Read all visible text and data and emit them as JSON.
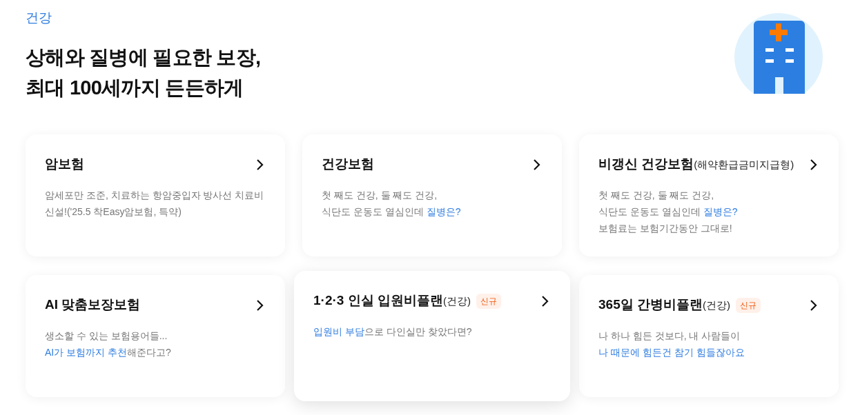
{
  "category": "건강",
  "headline": [
    "상해와 질병에 필요한 보장,",
    "최대 100세까지 든든하게"
  ],
  "cards": [
    {
      "title": "암보험",
      "raised": false,
      "lines": [
        [
          {
            "text": "암세포만 조준, 치료하는 항암중입자 방사선 치료비",
            "highlight": false
          }
        ],
        [
          {
            "text": "신설!('25.5 착Easy암보험, 특약)",
            "highlight": false
          }
        ]
      ]
    },
    {
      "title": "건강보험",
      "raised": false,
      "lines": [
        [
          {
            "text": "첫 째도 건강, 둘 째도 건강,",
            "highlight": false
          }
        ],
        [
          {
            "text": "식단도 운동도 열심인데 ",
            "highlight": false
          },
          {
            "text": "질병은?",
            "highlight": true
          }
        ]
      ]
    },
    {
      "title": "비갱신 건강보험",
      "title_suffix": "(해약환급금미지급형)",
      "raised": false,
      "lines": [
        [
          {
            "text": "첫 째도 건강, 둘 째도 건강,",
            "highlight": false
          }
        ],
        [
          {
            "text": "식단도 운동도 열심인데 ",
            "highlight": false
          },
          {
            "text": "질병은?",
            "highlight": true
          }
        ],
        [
          {
            "text": "보험료는 보험기간동안 그대로!",
            "highlight": false
          }
        ]
      ]
    },
    {
      "title": "AI 맞춤보장보험",
      "raised": false,
      "lines": [
        [
          {
            "text": "생소할 수 있는 보험용어들...",
            "highlight": false
          }
        ],
        [
          {
            "text": "AI가 보험까지 추천",
            "highlight": true
          },
          {
            "text": "해준다고?",
            "highlight": false
          }
        ]
      ]
    },
    {
      "title": "1·2·3 인실 입원비플랜",
      "title_suffix": "(건강)",
      "badge": "신규",
      "raised": true,
      "lines": [
        [
          {
            "text": "입원비 부담",
            "highlight": true
          },
          {
            "text": "으로 다인실만 찾았다면?",
            "highlight": false
          }
        ]
      ]
    },
    {
      "title": "365일 간병비플랜",
      "title_suffix": "(건강)",
      "badge": "신규",
      "raised": false,
      "lines": [
        [
          {
            "text": "나 하나 힘든 것보다, 내 사람들이",
            "highlight": false
          }
        ],
        [
          {
            "text": "나 때문에 힘든건 참기 힘들잖아요",
            "highlight": true
          }
        ]
      ]
    }
  ]
}
